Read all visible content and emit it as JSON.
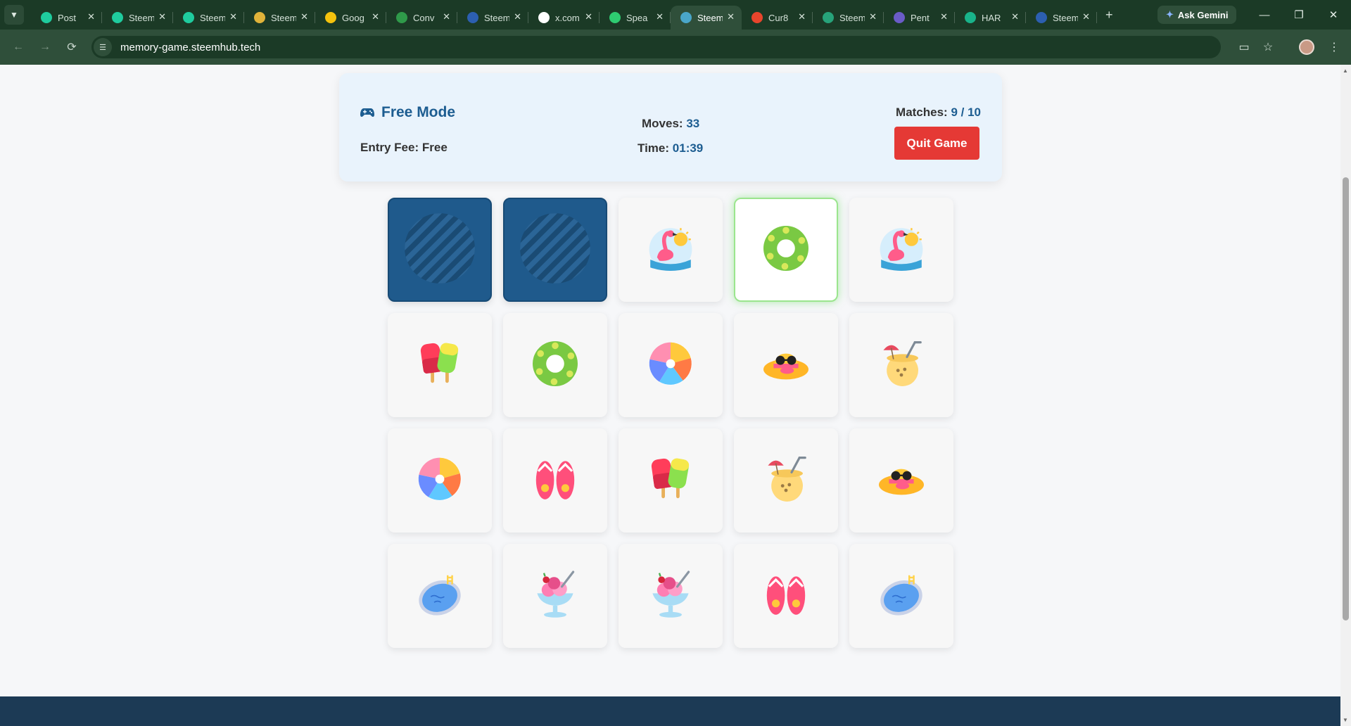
{
  "browser": {
    "tabs": [
      {
        "title": "Post",
        "color": "#1fcc9e"
      },
      {
        "title": "Steem",
        "color": "#1fcc9e"
      },
      {
        "title": "Steem",
        "color": "#1fcc9e"
      },
      {
        "title": "Steem",
        "color": "#e0b33a"
      },
      {
        "title": "Goog",
        "color": "#f4c20d"
      },
      {
        "title": "Conv",
        "color": "#2f9a4a"
      },
      {
        "title": "Steem",
        "color": "#2c5fb0"
      },
      {
        "title": "x.com",
        "color": "#ffffff"
      },
      {
        "title": "Spea",
        "color": "#2ecc71"
      },
      {
        "title": "Steem",
        "color": "#4aa6c9",
        "active": true
      },
      {
        "title": "Cur8",
        "color": "#e8452c"
      },
      {
        "title": "Steem",
        "color": "#27a37a"
      },
      {
        "title": "Pent",
        "color": "#6a5cc7"
      },
      {
        "title": "HAR",
        "color": "#19b38a"
      },
      {
        "title": "Steem",
        "color": "#2c5fb0"
      }
    ],
    "ask_gemini": "Ask Gemini",
    "url": "memory-game.steemhub.tech"
  },
  "game": {
    "mode": "Free Mode",
    "entry_fee_label": "Entry Fee:",
    "entry_fee_value": "Free",
    "moves_label": "Moves:",
    "moves_value": "33",
    "time_label": "Time:",
    "time_value": "01:39",
    "matches_label": "Matches:",
    "matches_value": "9 / 10",
    "quit_label": "Quit Game"
  },
  "board": {
    "cards": [
      {
        "face": "back",
        "icon": "card-back-icon"
      },
      {
        "face": "back",
        "icon": "card-back-icon"
      },
      {
        "face": "flamingo",
        "icon": "flamingo-float-icon"
      },
      {
        "face": "swim-ring",
        "icon": "swim-ring-icon",
        "selected": true
      },
      {
        "face": "flamingo",
        "icon": "flamingo-float-icon"
      },
      {
        "face": "popsicle",
        "icon": "popsicle-icon"
      },
      {
        "face": "swim-ring",
        "icon": "swim-ring-icon"
      },
      {
        "face": "beach-ball",
        "icon": "beach-ball-icon"
      },
      {
        "face": "sun-hat",
        "icon": "sun-hat-icon"
      },
      {
        "face": "coconut",
        "icon": "coconut-drink-icon"
      },
      {
        "face": "beach-ball",
        "icon": "beach-ball-icon"
      },
      {
        "face": "flip-flops",
        "icon": "flip-flops-icon"
      },
      {
        "face": "popsicle",
        "icon": "popsicle-icon"
      },
      {
        "face": "coconut",
        "icon": "coconut-drink-icon"
      },
      {
        "face": "sun-hat",
        "icon": "sun-hat-icon"
      },
      {
        "face": "pool",
        "icon": "pool-icon"
      },
      {
        "face": "sundae",
        "icon": "ice-cream-sundae-icon"
      },
      {
        "face": "sundae",
        "icon": "ice-cream-sundae-icon"
      },
      {
        "face": "flip-flops",
        "icon": "flip-flops-icon"
      },
      {
        "face": "pool",
        "icon": "pool-icon"
      }
    ]
  },
  "colors": {
    "accent": "#1d5d91",
    "quit": "#e53935",
    "card_back": "#1f5a8c",
    "selected_glow": "#9be58e"
  }
}
